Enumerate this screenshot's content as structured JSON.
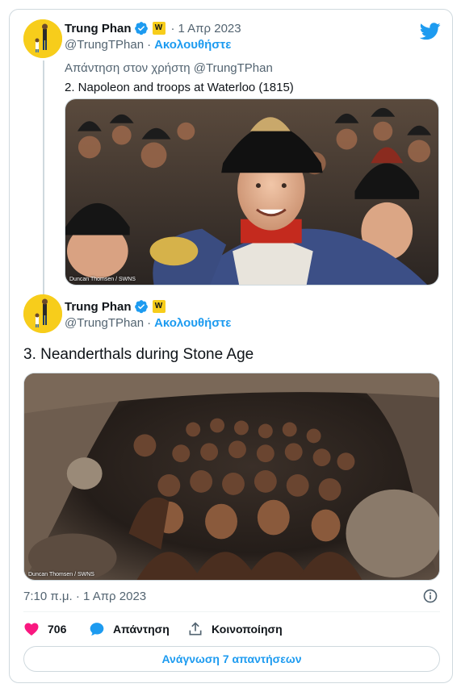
{
  "brand": {
    "twitter_blue": "#1d9bf0",
    "like_red": "#f91880",
    "badge_yellow": "#f7cd1b"
  },
  "tweet1": {
    "author_name": "Trung Phan",
    "badge_text": "W",
    "date": "1 Απρ 2023",
    "handle": "@TrungTPhan",
    "follow_label": "Ακολουθήστε",
    "reply_to": "Απάντηση στον χρήστη @TrungTPhan",
    "text": "2. Napoleon and troops at Waterloo (1815)",
    "image_credit": "Duncan Thomsen / SWNS"
  },
  "tweet2": {
    "author_name": "Trung Phan",
    "badge_text": "W",
    "handle": "@TrungTPhan",
    "follow_label": "Ακολουθήστε",
    "text": "3. Neanderthals during Stone Age",
    "image_credit": "Duncan Thomsen / SWNS",
    "timestamp": "7:10 π.μ. · 1 Απρ 2023"
  },
  "actions": {
    "like_count": "706",
    "reply_label": "Απάντηση",
    "share_label": "Κοινοποίηση"
  },
  "read_replies_label": "Ανάγνωση 7 απαντήσεων",
  "icons": [
    "twitter-bird-icon",
    "verified-icon",
    "heart-icon",
    "reply-icon",
    "share-icon",
    "info-icon"
  ]
}
